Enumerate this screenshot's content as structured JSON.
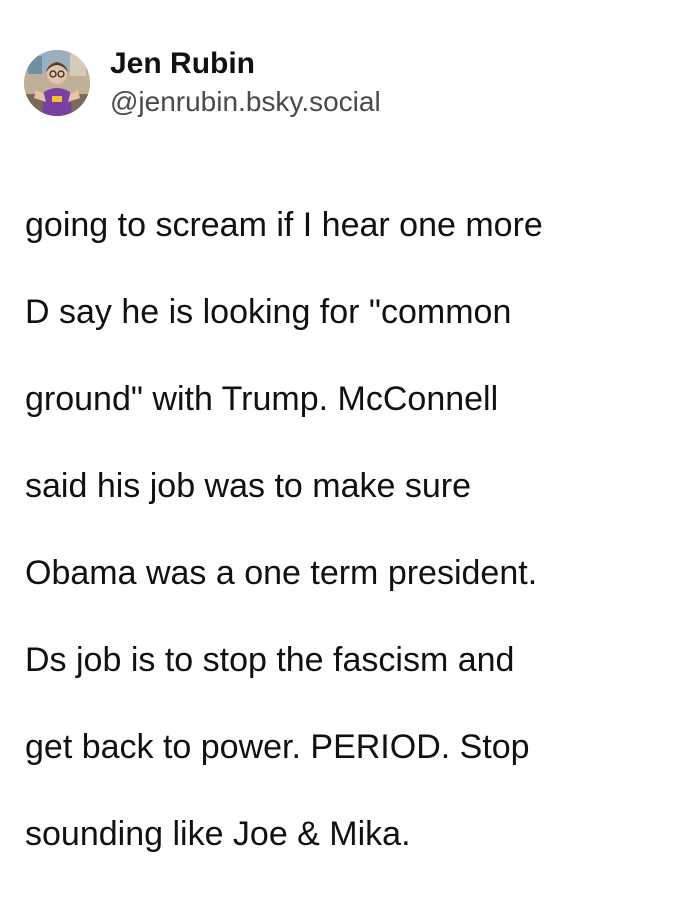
{
  "post": {
    "author": {
      "display_name": "Jen Rubin",
      "handle": "@jenrubin.bsky.social",
      "avatar_icon": "profile-photo"
    },
    "text_lines": [
      "going to scream if I hear one more",
      "D say he is looking for \"common",
      "ground\" with Trump. McConnell",
      "said his job was to make sure",
      "Obama was a one term president.",
      "Ds job is to stop the fascism and",
      "get back to power. PERIOD. Stop",
      "sounding like Joe & Mika."
    ]
  }
}
